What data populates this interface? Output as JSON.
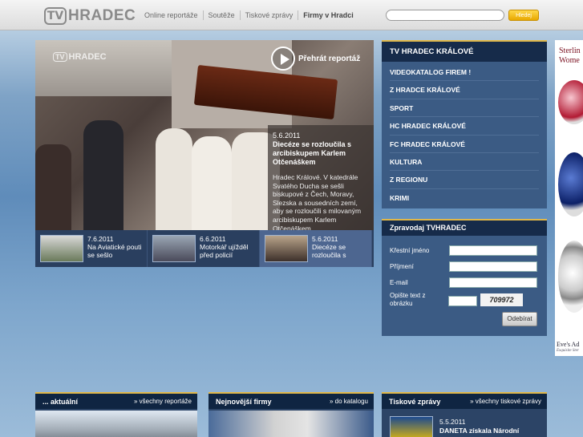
{
  "header": {
    "logo_tv": "TV",
    "logo_text": "HRADEC",
    "nav": [
      "Online reportáže",
      "Soutěže",
      "Tiskové zprávy",
      "Firmy v Hradci"
    ],
    "search_placeholder": "",
    "search_button": "Hledej"
  },
  "video": {
    "watermark_tv": "TV",
    "watermark_text": "HRADEC",
    "play_label": "Přehrát reportáž",
    "story": {
      "date": "5.6.2011",
      "title": "Diecéze se rozloučila s arcibiskupem Karlem Otčenáškem",
      "text": "Hradec Králové. V katedrále Svatého Ducha se sešli biskupové z Čech, Moravy, Slezska a sousedních zemí, aby se rozloučili s milovaným arcibiskupem Karlem Otčenáškem"
    },
    "thumbs": [
      {
        "date": "7.6.2011",
        "title": "Na Aviatické pouti se sešlo"
      },
      {
        "date": "6.6.2011",
        "title": "Motorkář ujížděl před policií"
      },
      {
        "date": "5.6.2011",
        "title": "Diecéze se rozloučila s"
      }
    ]
  },
  "rightmenu": {
    "title": "TV HRADEC KRÁLOVÉ",
    "items": [
      "VIDEOKATALOG FIREM !",
      "Z HRADCE KRÁLOVÉ",
      "SPORT",
      "HC HRADEC KRÁLOVÉ",
      "FC HRADEC KRÁLOVÉ",
      "KULTURA",
      "Z REGIONU",
      "KRIMI"
    ]
  },
  "newsletter": {
    "title": "Zpravodaj TVHRADEC",
    "first_name": "Křestní jméno",
    "last_name": "Příjmení",
    "email": "E-mail",
    "captcha_label": "Opište text z obrázku",
    "captcha_value": "709972",
    "submit": "Odebírat"
  },
  "ad": {
    "line1": "Sterlin",
    "line2": "Wome",
    "brand": "Eve's Ad",
    "tagline": "Exquisite Ster"
  },
  "bottom": {
    "box1": {
      "title": "... aktuální",
      "link": "» všechny reportáže"
    },
    "box2": {
      "title": "Nejnovější firmy",
      "link": "» do katalogu"
    },
    "box3": {
      "title": "Tiskové zprávy",
      "link": "» všechny tiskové zprávy",
      "date": "5.5.2011",
      "headline": "DANETA získala Národní"
    }
  }
}
